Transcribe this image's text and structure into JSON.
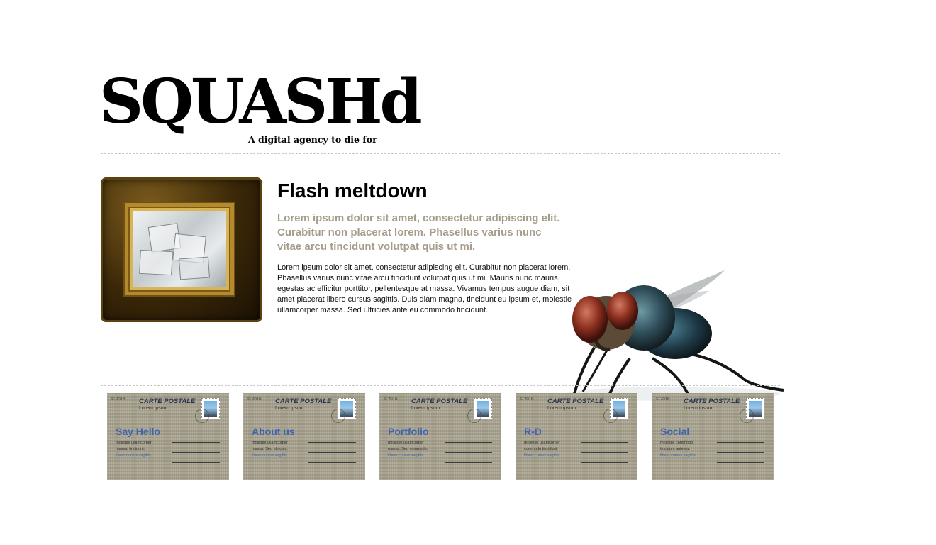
{
  "header": {
    "logo": "SQUASHd",
    "tagline": "A digital agency to die for"
  },
  "article": {
    "title": "Flash meltdown",
    "lead": "Lorem ipsum dolor sit amet, consectetur adipiscing elit. Curabitur non placerat lorem. Phasellus varius nunc vitae arcu tincidunt volutpat quis ut mi.",
    "body": "Lorem ipsum dolor sit amet, consectetur adipiscing elit. Curabitur non placerat lorem. Phasellus varius nunc vitae arcu tincidunt volutpat quis ut mi. Mauris nunc mauris, egestas ac efficitur porttitor, pellentesque at massa. Vivamus tempus augue diam, sit amet placerat libero cursus sagittis. Duis diam magna, tincidunt eu ipsum et, molestie ullamcorper massa. Sed ultricies ante eu commodo tincidunt."
  },
  "cards": [
    {
      "year": "© 2016",
      "heading": "CARTE POSTALE",
      "subheading": "Lorem ipsum",
      "title": "Say Hello",
      "line1": "molestie ullamcorper",
      "line2": "massa. tincidunt.",
      "link": "libero cursus sagittis."
    },
    {
      "year": "© 2016",
      "heading": "CARTE POSTALE",
      "subheading": "Lorem ipsum",
      "title": "About us",
      "line1": "molestie ullamcorper",
      "line2": "massa. Sed ultricies.",
      "link": "libero cursus sagittis."
    },
    {
      "year": "© 2016",
      "heading": "CARTE POSTALE",
      "subheading": "Lorem ipsum",
      "title": "Portfolio",
      "line1": "molestie ullamcorper",
      "line2": "massa. Sed commodo.",
      "link": "libero cursus sagittis."
    },
    {
      "year": "© 2016",
      "heading": "CARTE POSTALE",
      "subheading": "Lorem ipsum",
      "title": "R-D",
      "line1": "molestie ullamcorper",
      "line2": "commodo tincidunt.",
      "link": "libero cursus sagittis."
    },
    {
      "year": "© 2016",
      "heading": "CARTE POSTALE",
      "subheading": "Lorem ipsum",
      "title": "Social",
      "line1": "molestie commodo",
      "line2": "tincidunt ante eu.",
      "link": "libero cursus sagittis."
    }
  ],
  "colors": {
    "accent_blue": "#3e63b3",
    "lead_text": "#a59d8a",
    "card_background": "#aba590"
  },
  "icons": {
    "stamp": "stamp-icon",
    "fly": "fly-image"
  }
}
